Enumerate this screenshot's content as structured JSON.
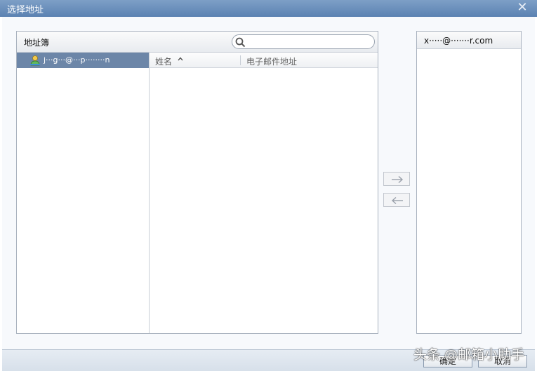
{
  "window": {
    "title": "选择地址"
  },
  "address_book": {
    "title": "地址簿",
    "search_placeholder": "",
    "selected_book": "j···g···@···p········n",
    "columns": {
      "name": "姓名",
      "email": "电子邮件地址"
    }
  },
  "recipients": {
    "label": "x·····@·······r.com"
  },
  "buttons": {
    "ok": "确定",
    "cancel": "取消"
  },
  "watermark": "头条 @邮箱小助手",
  "colors": {
    "title_bar": "#6a8dba",
    "selection": "#6c86a8"
  }
}
